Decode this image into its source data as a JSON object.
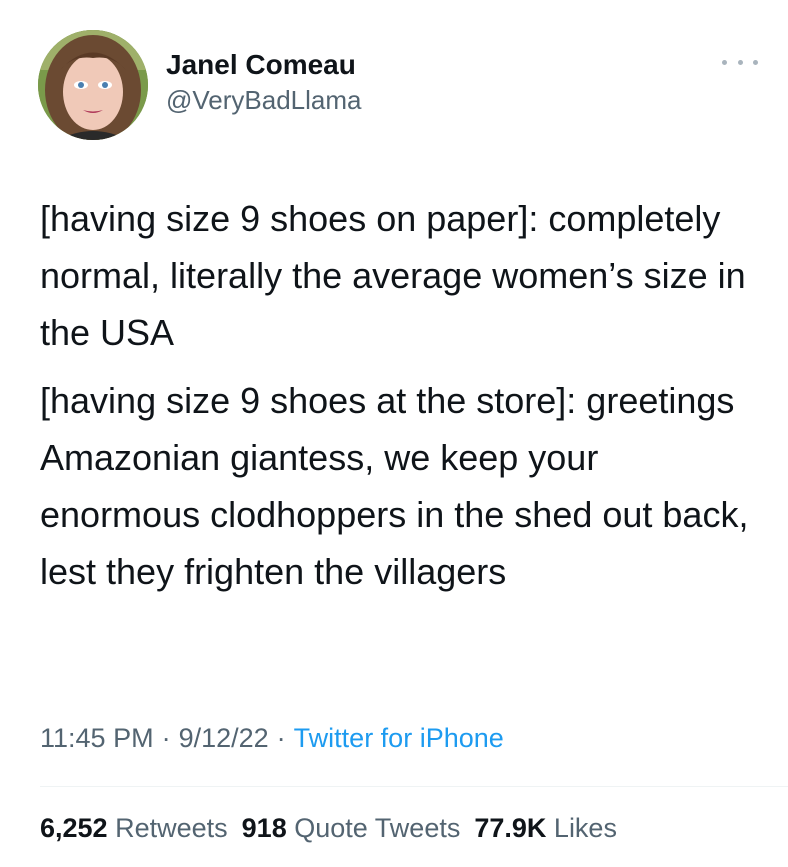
{
  "author": {
    "display_name": "Janel Comeau",
    "handle": "@VeryBadLlama",
    "avatar_icon": "user-avatar-photo"
  },
  "more_icon": "more-options-icon",
  "tweet": {
    "paragraphs": [
      "[having size 9 shoes on paper]: completely normal, literally the average women’s size in the USA",
      "[having size 9 shoes at the store]: greetings Amazonian giantess, we keep your enormous clodhoppers in the shed out back, lest they frighten the villagers"
    ]
  },
  "meta": {
    "time": "11:45 PM",
    "date": "9/12/22",
    "separator": "·",
    "source": "Twitter for iPhone"
  },
  "stats": {
    "retweets_count": "6,252",
    "retweets_label": "Retweets",
    "quotes_count": "918",
    "quotes_label": "Quote Tweets",
    "likes_count": "77.9K",
    "likes_label": "Likes"
  },
  "colors": {
    "text": "#0f1419",
    "secondary": "#536471",
    "link": "#1d9bf0",
    "divider": "#eff3f4"
  }
}
